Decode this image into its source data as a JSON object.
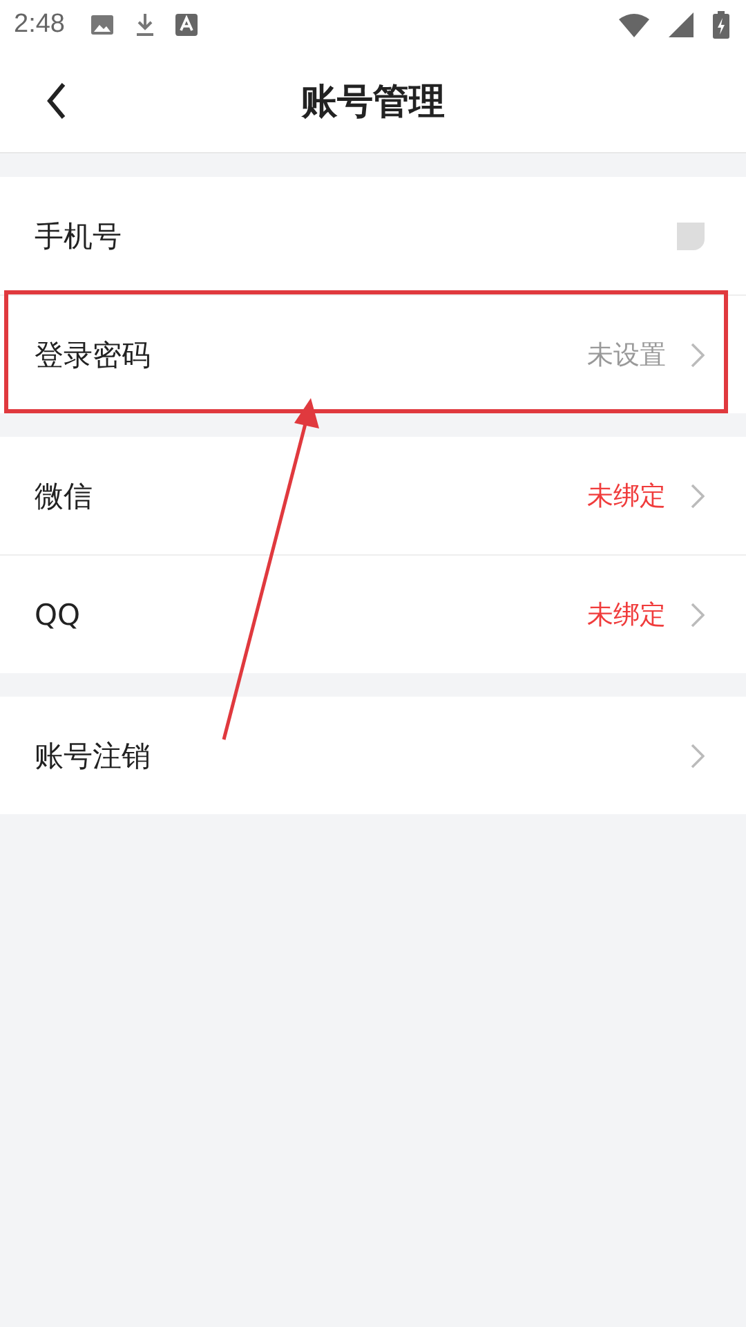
{
  "status_bar": {
    "time": "2:48"
  },
  "header": {
    "title": "账号管理"
  },
  "sections": [
    {
      "rows": [
        {
          "label": "手机号",
          "kind": "masked"
        },
        {
          "label": "登录密码",
          "kind": "status",
          "value": "未设置",
          "alert": false,
          "annotated": true
        }
      ]
    },
    {
      "rows": [
        {
          "label": "微信",
          "kind": "status",
          "value": "未绑定",
          "alert": true
        },
        {
          "label": "QQ",
          "kind": "status",
          "value": "未绑定",
          "alert": true
        }
      ]
    },
    {
      "rows": [
        {
          "label": "账号注销",
          "kind": "link"
        }
      ]
    }
  ]
}
